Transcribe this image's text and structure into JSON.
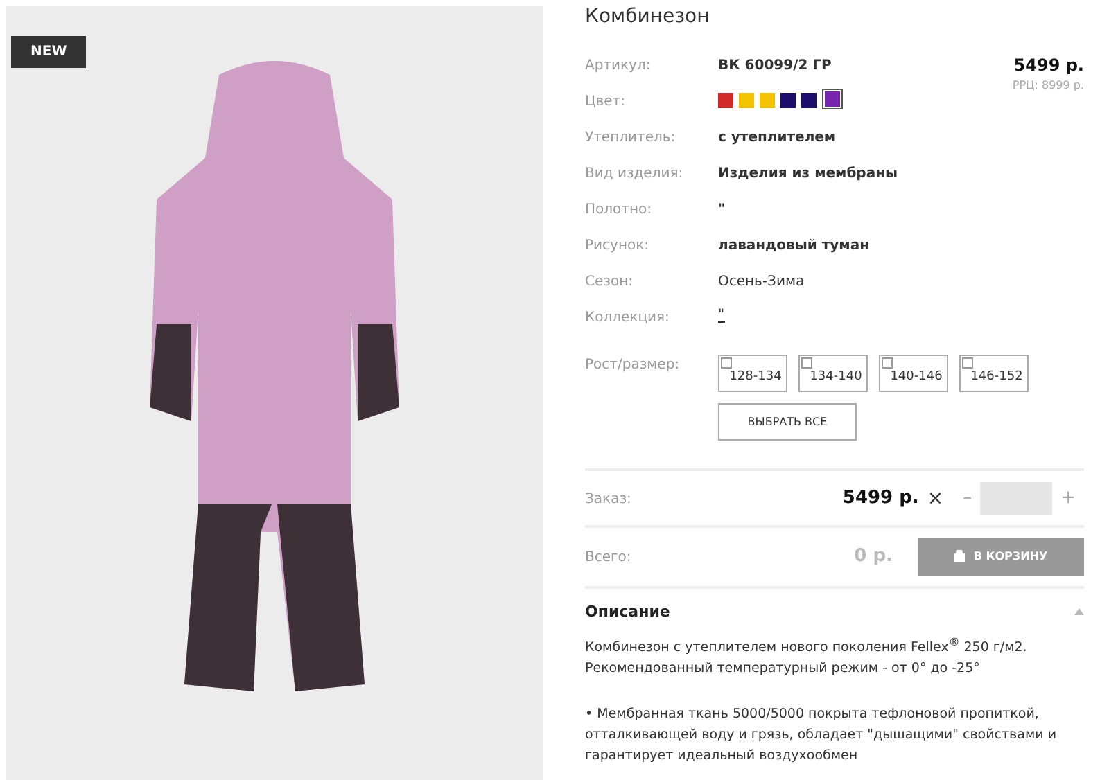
{
  "badge": "NEW",
  "title": "Комбинезон",
  "price": "5499 р.",
  "rrp": "РРЦ: 8999 р.",
  "specs": [
    {
      "label": "Артикул:",
      "value": "ВК 60099/2 ГР",
      "kind": "bold"
    },
    {
      "label": "Цвет:",
      "kind": "colors",
      "colors": [
        {
          "color": "#d12b2b",
          "selected": false
        },
        {
          "color": "#f5c400",
          "selected": false
        },
        {
          "color": "#f5c400",
          "selected": false
        },
        {
          "color": "#1c0f6b",
          "selected": false
        },
        {
          "color": "#1c0f6b",
          "selected": false
        },
        {
          "color": "#7a25b0",
          "selected": true
        }
      ]
    },
    {
      "label": "Утеплитель:",
      "value": "с утеплителем",
      "kind": "bold"
    },
    {
      "label": "Вид изделия:",
      "value": "Изделия из мембраны",
      "kind": "bold"
    },
    {
      "label": "Полотно:",
      "value": "\"",
      "kind": "bold"
    },
    {
      "label": "Рисунок:",
      "value": "лавандовый туман",
      "kind": "bold"
    },
    {
      "label": "Сезон:",
      "value": "Осень-Зима",
      "kind": "plain"
    },
    {
      "label": "Коллекция:",
      "value": "\"",
      "kind": "link"
    }
  ],
  "sizes_label": "Рост/размер:",
  "sizes": [
    {
      "label": "128-134",
      "checked": false
    },
    {
      "label": "134-140",
      "checked": false
    },
    {
      "label": "140-146",
      "checked": false
    },
    {
      "label": "146-152",
      "checked": false
    }
  ],
  "select_all": "ВЫБРАТЬ ВСЕ",
  "order": {
    "label": "Заказ:",
    "price": "5499 р.",
    "times": "×",
    "minus": "–",
    "plus": "+"
  },
  "total": {
    "label": "Всего:",
    "value": "0 р.",
    "cart": "В КОРЗИНУ",
    "disabled": true
  },
  "description": {
    "title": "Описание",
    "expanded": true,
    "paragraphs": [
      "Комбинезон с утеплителем нового поколения Fellex$^{®}$ 250 г/м2. Рекомендованный температурный режим - от 0° до -25°",
      "• Мембранная ткань 5000/5000 покрыта тефлоновой пропиткой, отталкивающей воду и грязь, обладает \"дышащими\" свойствами и гарантирует идеальный воздухообмен"
    ]
  }
}
